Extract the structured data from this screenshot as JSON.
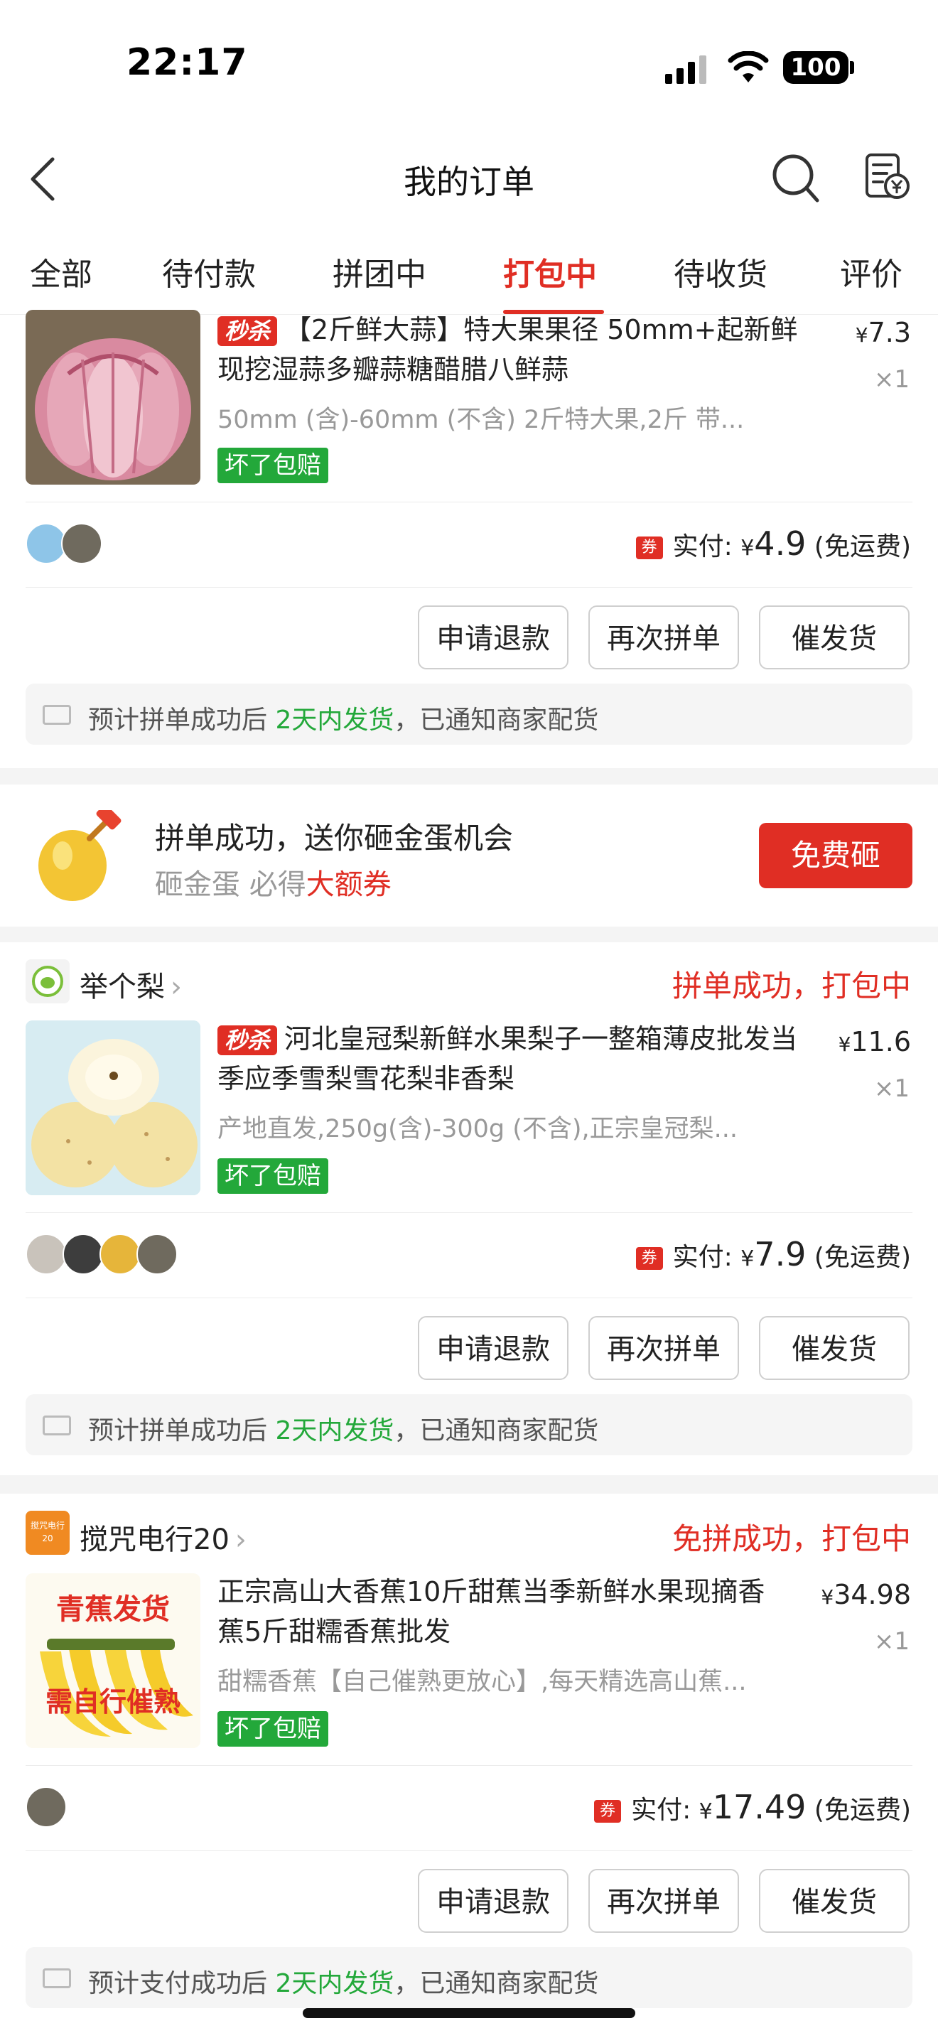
{
  "status_bar": {
    "time": "22:17",
    "battery": "100"
  },
  "nav": {
    "title": "我的订单"
  },
  "tabs": [
    {
      "label": "全部"
    },
    {
      "label": "待付款"
    },
    {
      "label": "拼团中"
    },
    {
      "label": "打包中"
    },
    {
      "label": "待收货"
    },
    {
      "label": "评价"
    }
  ],
  "active_tab": "打包中",
  "orders": [
    {
      "flash_label": "秒杀",
      "product_name": "【2斤鲜大蒜】特大果果径 50mm+起新鲜现挖湿蒜多瓣蒜糖醋腊八鲜蒜",
      "spec": "50mm (含)-60mm (不含) 2斤特大果,2斤 带...",
      "guarantee": "坏了包赔",
      "price_symbol": "¥",
      "price": "7.3",
      "qty": "×1",
      "paid_label": "实付:",
      "paid_symbol": "¥",
      "paid_amount": "4.9",
      "shipping": "(免运费)",
      "buttons": [
        "申请退款",
        "再次拼单",
        "催发货"
      ],
      "notice_pre": "预计拼单成功后",
      "notice_highlight": "2天内发货",
      "notice_post": "，已通知商家配货"
    },
    {
      "shop_name": "举个梨",
      "status": "拼单成功，打包中",
      "flash_label": "秒杀",
      "product_name": "河北皇冠梨新鲜水果梨子一整箱薄皮批发当季应季雪梨雪花梨非香梨",
      "spec": "产地直发,250g(含)-300g (不含),正宗皇冠梨...",
      "guarantee": "坏了包赔",
      "price_symbol": "¥",
      "price": "11.6",
      "qty": "×1",
      "paid_label": "实付:",
      "paid_symbol": "¥",
      "paid_amount": "7.9",
      "shipping": "(免运费)",
      "buttons": [
        "申请退款",
        "再次拼单",
        "催发货"
      ],
      "notice_pre": "预计拼单成功后",
      "notice_highlight": "2天内发货",
      "notice_post": "，已通知商家配货"
    },
    {
      "shop_name": "搅咒电行20",
      "shop_logo_text": "搅咒电行20",
      "status": "免拼成功，打包中",
      "product_name": "正宗高山大香蕉10斤甜蕉当季新鲜水果现摘香蕉5斤甜糯香蕉批发",
      "thumb_text_top": "青蕉发货",
      "thumb_text_bottom": "需自行催熟",
      "spec": "甜糯香蕉【自己催熟更放心】,每天精选高山蕉...",
      "guarantee": "坏了包赔",
      "price_symbol": "¥",
      "price": "34.98",
      "qty": "×1",
      "paid_label": "实付:",
      "paid_symbol": "¥",
      "paid_amount": "17.49",
      "shipping": "(免运费)",
      "buttons": [
        "申请退款",
        "再次拼单",
        "催发货"
      ],
      "notice_pre": "预计支付成功后",
      "notice_highlight": "2天内发货",
      "notice_post": "，已通知商家配货"
    }
  ],
  "egg_promo": {
    "title": "拼单成功，送你砸金蛋机会",
    "sub_pre": "砸金蛋 必得",
    "sub_highlight": "大额券",
    "button": "免费砸"
  },
  "colors": {
    "accent": "#e02e24",
    "green": "#23a83a"
  }
}
